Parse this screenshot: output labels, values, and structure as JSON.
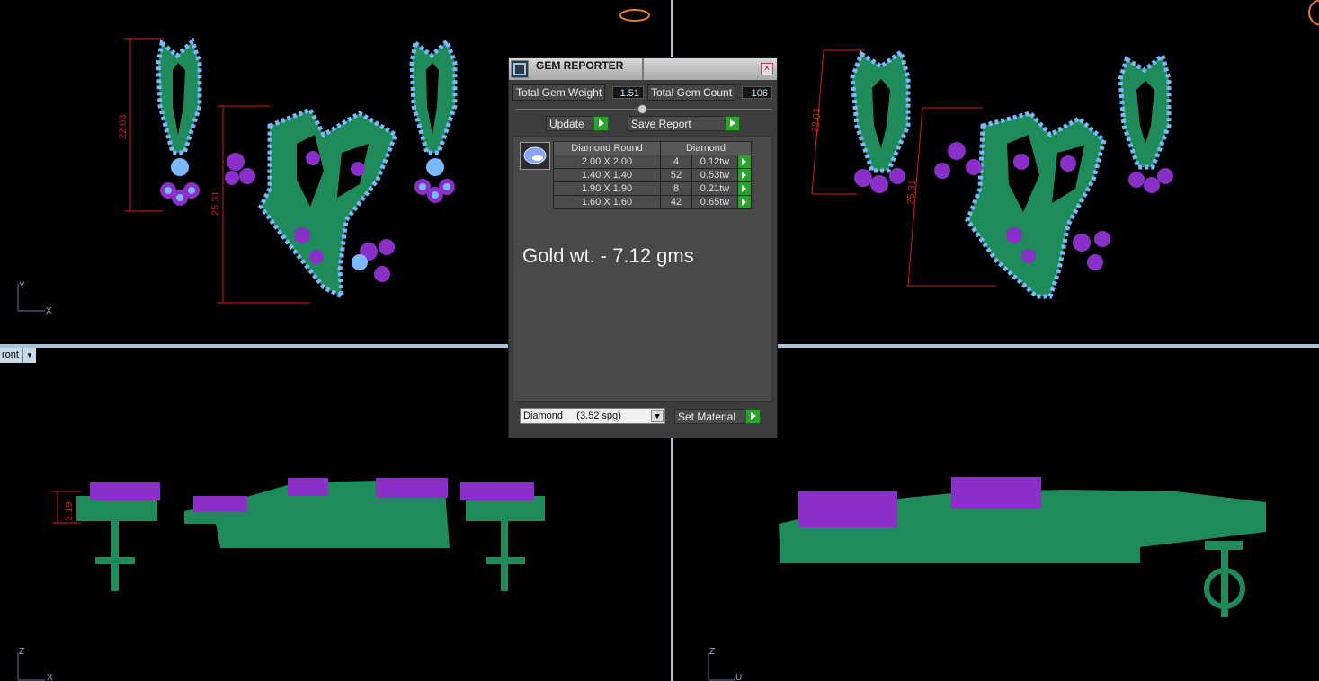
{
  "viewports": {
    "top_left": {
      "dimensions": [
        "22.03",
        "25.31"
      ],
      "axis": [
        "Y",
        "X"
      ]
    },
    "top_right": {
      "dimensions": [
        "22.03",
        "25.31"
      ],
      "axis": []
    },
    "bottom_left": {
      "view_label": "ront",
      "dimensions": [
        "3.19"
      ],
      "axis": [
        "Z",
        "X"
      ]
    },
    "bottom_right": {
      "axis": [
        "Z",
        "U"
      ]
    }
  },
  "colors": {
    "metal": "#1f8a5a",
    "stone": "#7ab8ff",
    "prong": "#8a2fc8",
    "dimension": "#d21c1c",
    "divider": "#a9c4d6"
  },
  "gem_reporter": {
    "title": "GEM REPORTER",
    "total_weight_label": "Total Gem Weight",
    "total_weight_value": "1.51",
    "total_count_label": "Total Gem Count",
    "total_count_value": "106",
    "update_label": "Update",
    "save_label": "Save Report",
    "table_header": [
      "Diamond Round",
      "Diamond"
    ],
    "rows": [
      {
        "size": "2.00 X 2.00",
        "count": "4",
        "weight": "0.12tw"
      },
      {
        "size": "1.40 X 1.40",
        "count": "52",
        "weight": "0.53tw"
      },
      {
        "size": "1.90 X 1.90",
        "count": "8",
        "weight": "0.21tw"
      },
      {
        "size": "1.60 X 1.60",
        "count": "42",
        "weight": "0.65tw"
      }
    ],
    "note": "Gold wt. - 7.12 gms",
    "material_select": "Diamond     (3.52 spg)",
    "set_material_label": "Set Material"
  }
}
